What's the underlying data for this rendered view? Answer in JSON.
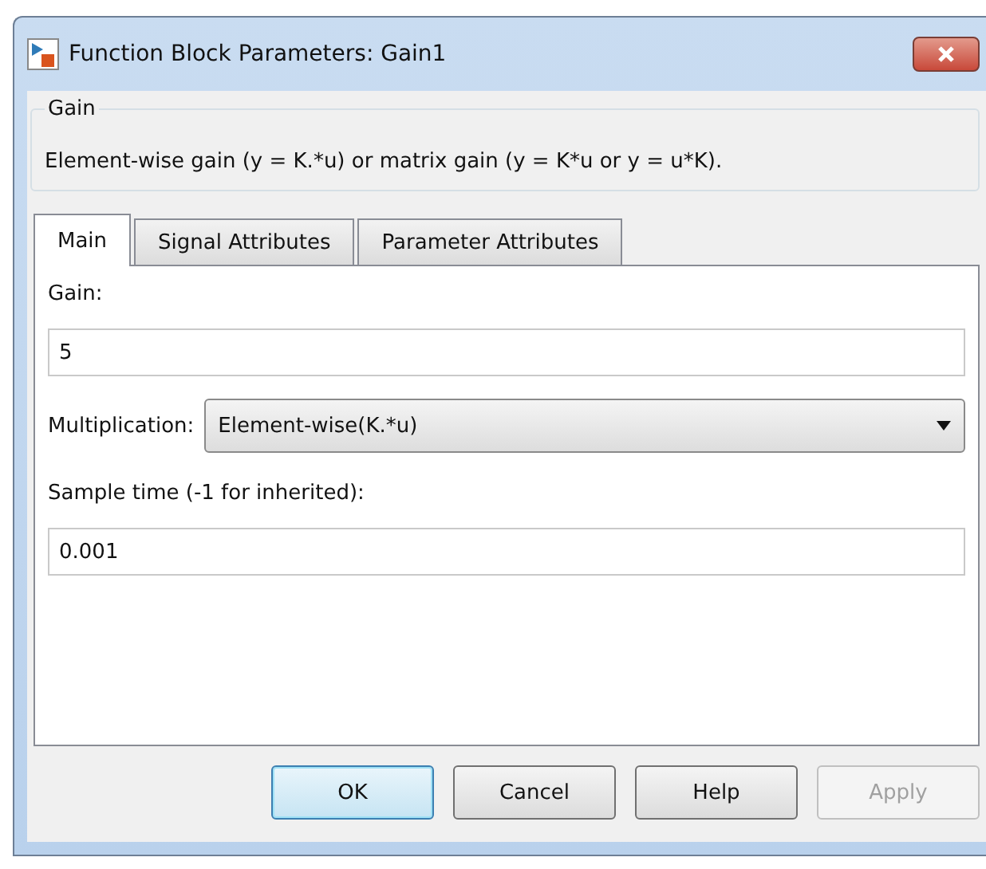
{
  "window": {
    "title": "Function Block Parameters: Gain1"
  },
  "group": {
    "title": "Gain",
    "description": "Element-wise gain (y = K.*u) or matrix gain (y = K*u or y = u*K)."
  },
  "tabs": [
    {
      "label": "Main",
      "selected": true
    },
    {
      "label": "Signal Attributes",
      "selected": false
    },
    {
      "label": "Parameter Attributes",
      "selected": false
    }
  ],
  "fields": [
    {
      "kind": "text",
      "label": "Gain:",
      "value": "5"
    },
    {
      "kind": "dropdown",
      "label": "Multiplication:",
      "value": "Element-wise(K.*u)"
    },
    {
      "kind": "text",
      "label": "Sample time (-1 for inherited):",
      "value": "0.001"
    }
  ],
  "buttons": [
    {
      "label": "OK",
      "default": true,
      "disabled": false
    },
    {
      "label": "Cancel",
      "default": false,
      "disabled": false
    },
    {
      "label": "Help",
      "default": false,
      "disabled": false
    },
    {
      "label": "Apply",
      "default": false,
      "disabled": true
    }
  ]
}
